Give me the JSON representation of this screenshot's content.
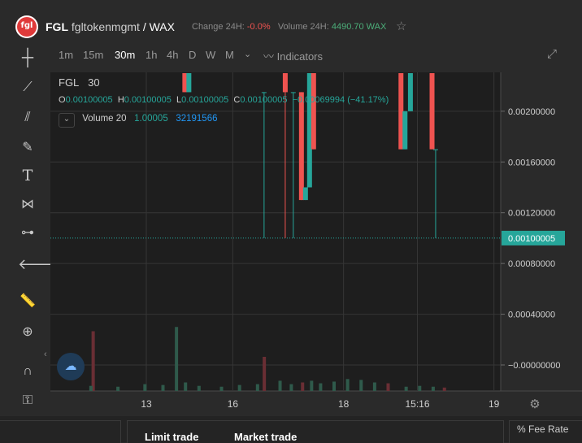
{
  "header": {
    "logo_text": "fgl",
    "symbol": "FGL",
    "contract": "fgltokenmgmt",
    "quote": "/ WAX",
    "change_label": "Change 24H:",
    "change_value": "-0.0%",
    "volume_label": "Volume 24H:",
    "volume_value": "4490.70 WAX"
  },
  "timeframes": [
    "1m",
    "15m",
    "30m",
    "1h",
    "4h",
    "D",
    "W",
    "M"
  ],
  "active_timeframe": "30m",
  "indicators_label": "Indicators",
  "legend": {
    "symbol": "FGL",
    "interval": "30",
    "o_label": "O",
    "o": "0.00100005",
    "h_label": "H",
    "h": "0.00100005",
    "l_label": "L",
    "l": "0.00100005",
    "c_label": "C",
    "c": "0.00100005",
    "change": "−0.00069994 (−41.17%)",
    "volume_label": "Volume 20",
    "volume_ma": "1.00005",
    "volume_value": "32191566"
  },
  "chart_data": {
    "type": "candlestick",
    "x_ticks": [
      "13",
      "16",
      "18",
      "15:16",
      "19"
    ],
    "y_ticks": [
      "0.00200000",
      "0.00160000",
      "0.00120000",
      "0.00080000",
      "0.00040000",
      "−0.00000000"
    ],
    "ylim": [
      0.0,
      0.0023
    ],
    "last_price": 0.00100005,
    "last_price_label": "0.00100005",
    "colors": {
      "up": "#26a69a",
      "down": "#ef5350",
      "grid": "#363636",
      "bg": "#1e1e1e"
    },
    "candles": [
      {
        "x": 0.2985,
        "open": 0.0023,
        "close": 0.00215,
        "high": 0.0023,
        "low": 0.00215
      },
      {
        "x": 0.3075,
        "open": 0.00215,
        "close": 0.0023,
        "high": 0.0023,
        "low": 0.00215
      },
      {
        "x": 0.4745,
        "open": 0.00215,
        "close": 0.00215,
        "high": 0.00215,
        "low": 0.001
      },
      {
        "x": 0.5215,
        "open": 0.0023,
        "close": 0.00215,
        "high": 0.0023,
        "low": 0.001
      },
      {
        "x": 0.5394,
        "open": 0.00215,
        "close": 0.00215,
        "high": 0.00215,
        "low": 0.001
      },
      {
        "x": 0.5575,
        "open": 0.00215,
        "close": 0.0013,
        "high": 0.00215,
        "low": 0.0013
      },
      {
        "x": 0.5665,
        "open": 0.0013,
        "close": 0.0014,
        "high": 0.0014,
        "low": 0.0013
      },
      {
        "x": 0.5755,
        "open": 0.0014,
        "close": 0.0023,
        "high": 0.0023,
        "low": 0.0014
      },
      {
        "x": 0.5845,
        "open": 0.0023,
        "close": 0.0017,
        "high": 0.0023,
        "low": 0.0017
      },
      {
        "x": 0.7785,
        "open": 0.0023,
        "close": 0.0017,
        "high": 0.0023,
        "low": 0.0017
      },
      {
        "x": 0.7875,
        "open": 0.0017,
        "close": 0.002,
        "high": 0.002,
        "low": 0.0017
      },
      {
        "x": 0.7995,
        "open": 0.002,
        "close": 0.0023,
        "high": 0.0023,
        "low": 0.002
      },
      {
        "x": 0.8475,
        "open": 0.0023,
        "close": 0.0017,
        "high": 0.0023,
        "low": 0.0017
      },
      {
        "x": 0.8555,
        "open": 0.0017,
        "close": 0.0017,
        "high": 0.0017,
        "low": 0.001
      }
    ],
    "volume_bars": [
      {
        "x": 0.095,
        "v": 0.7,
        "up": false
      },
      {
        "x": 0.28,
        "v": 0.75,
        "up": true
      },
      {
        "x": 0.475,
        "v": 0.4,
        "up": false
      },
      {
        "x": 0.09,
        "v": 0.06,
        "up": true
      },
      {
        "x": 0.15,
        "v": 0.05,
        "up": true
      },
      {
        "x": 0.21,
        "v": 0.08,
        "up": true
      },
      {
        "x": 0.25,
        "v": 0.07,
        "up": true
      },
      {
        "x": 0.3,
        "v": 0.1,
        "up": true
      },
      {
        "x": 0.33,
        "v": 0.06,
        "up": true
      },
      {
        "x": 0.38,
        "v": 0.05,
        "up": true
      },
      {
        "x": 0.42,
        "v": 0.07,
        "up": true
      },
      {
        "x": 0.46,
        "v": 0.08,
        "up": true
      },
      {
        "x": 0.51,
        "v": 0.12,
        "up": true
      },
      {
        "x": 0.535,
        "v": 0.08,
        "up": true
      },
      {
        "x": 0.56,
        "v": 0.1,
        "up": false
      },
      {
        "x": 0.58,
        "v": 0.12,
        "up": true
      },
      {
        "x": 0.6,
        "v": 0.09,
        "up": true
      },
      {
        "x": 0.63,
        "v": 0.11,
        "up": true
      },
      {
        "x": 0.66,
        "v": 0.14,
        "up": true
      },
      {
        "x": 0.69,
        "v": 0.13,
        "up": true
      },
      {
        "x": 0.72,
        "v": 0.1,
        "up": true
      },
      {
        "x": 0.75,
        "v": 0.09,
        "up": false
      },
      {
        "x": 0.79,
        "v": 0.05,
        "up": true
      },
      {
        "x": 0.82,
        "v": 0.06,
        "up": true
      },
      {
        "x": 0.85,
        "v": 0.05,
        "up": true
      },
      {
        "x": 0.875,
        "v": 0.04,
        "up": false
      }
    ]
  },
  "bottom": {
    "tab_limit": "Limit trade",
    "tab_market": "Market trade",
    "fee_label": "% Fee Rate"
  },
  "icons": {
    "crosshair": "crosshair-icon",
    "trendline": "trend-line-icon",
    "fib": "fib-icon",
    "brush": "brush-icon",
    "text": "text-icon",
    "pattern": "pattern-icon",
    "measure": "measure-icon",
    "back": "back-arrow-icon",
    "ruler": "ruler-icon",
    "zoom": "zoom-in-icon",
    "magnet": "magnet-icon",
    "lock": "lock-drawings-icon",
    "star": "favorite-star-icon",
    "fullscreen": "fullscreen-icon",
    "settings": "settings-gear-icon",
    "cloud": "cloud-icon"
  }
}
